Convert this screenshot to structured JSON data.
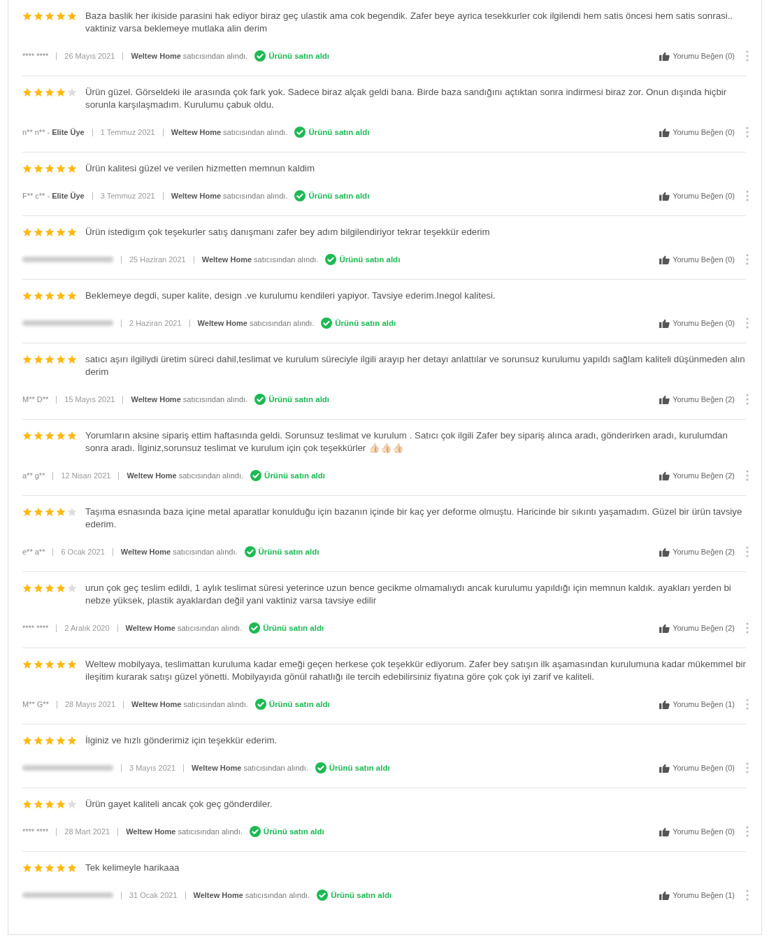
{
  "reviews": [
    {
      "stars": 5,
      "text": "Baza baslik her ikiside parasini hak ediyor biraz geç ulastik ama cok begendik. Zafer beye ayrica tesekkurler cok ilgilendi hem satis öncesi hem satis sonrasi.. vaktiniz varsa beklemeye mutlaka alin derim",
      "author": {
        "kind": "text",
        "name": "**** ****"
      },
      "date": "26 Mayıs 2021",
      "seller": "Weltew Home",
      "seller_note": "satıcısından alındı.",
      "verified": "Ürünü satın aldı",
      "like": "Yorumu Beğen (0)"
    },
    {
      "stars": 4,
      "text": "Ürün güzel. Görseldeki ile arasında çok fark yok. Sadece biraz alçak geldi bana. Birde baza sandığını açtıktan sonra indirmesi biraz zor. Onun dışında hiçbir sorunla karşılaşmadım. Kurulumu çabuk oldu.",
      "author": {
        "kind": "text",
        "name": "n** n** -",
        "badge": "Elite Üye"
      },
      "date": "1 Temmuz 2021",
      "seller": "Weltew Home",
      "seller_note": "satıcısından alındı.",
      "verified": "Ürünü satın aldı",
      "like": "Yorumu Beğen (0)"
    },
    {
      "stars": 5,
      "text": "Ürün kalitesi güzel ve verilen hizmetten memnun kaldim",
      "author": {
        "kind": "text",
        "name": "F** c** -",
        "badge": "Elite Üye"
      },
      "date": "3 Temmuz 2021",
      "seller": "Weltew Home",
      "seller_note": "satıcısından alındı.",
      "verified": "Ürünü satın aldı",
      "like": "Yorumu Beğen (0)"
    },
    {
      "stars": 5,
      "text": "Ürün istedigım çok teşekurler satış danışmanı zafer bey adım bilgilendiriyor tekrar teşekkür ederim",
      "author": {
        "kind": "blurred"
      },
      "date": "25 Haziran 2021",
      "seller": "Weltew Home",
      "seller_note": "satıcısından alındı.",
      "verified": "Ürünü satın aldı",
      "like": "Yorumu Beğen (0)"
    },
    {
      "stars": 5,
      "text": "Beklemeye degdi, super kalite, design .ve kurulumu kendileri yapiyor. Tavsiye ederim.Inegol kalitesi.",
      "author": {
        "kind": "blurred"
      },
      "date": "2 Haziran 2021",
      "seller": "Weltew Home",
      "seller_note": "satıcısından alındı.",
      "verified": "Ürünü satın aldı",
      "like": "Yorumu Beğen (0)"
    },
    {
      "stars": 5,
      "text": "satıcı aşırı ilgiliydi üretim süreci dahil,teslimat ve kurulum süreciyle ilgili arayıp her detayı anlattılar ve sorunsuz kurulumu yapıldı sağlam kaliteli düşünmeden alın derim",
      "author": {
        "kind": "text",
        "name": "M** D**"
      },
      "date": "15 Mayıs 2021",
      "seller": "Weltew Home",
      "seller_note": "satıcısından alındı.",
      "verified": "Ürünü satın aldı",
      "like": "Yorumu Beğen (2)"
    },
    {
      "stars": 5,
      "text": "Yorumların aksine sipariş ettim haftasında geldi. Sorunsuz teslimat ve kurulum . Satıcı çok ilgili Zafer bey sipariş alınca aradı, gönderirken aradı, kurulumdan sonra aradı. İlginiz,sorunsuz teslimat ve kurulum için çok teşekkürler 👍🏻👍🏻👍🏻",
      "author": {
        "kind": "text",
        "name": "a** g**"
      },
      "date": "12 Nisan 2021",
      "seller": "Weltew Home",
      "seller_note": "satıcısından alındı.",
      "verified": "Ürünü satın aldı",
      "like": "Yorumu Beğen (2)"
    },
    {
      "stars": 4,
      "text": "Taşıma esnasında baza içine metal aparatlar konulduğu için bazanın içinde bir kaç yer deforme olmuştu. Haricinde bir sıkıntı yaşamadım. Güzel bir ürün tavsiye ederim.",
      "author": {
        "kind": "text",
        "name": "e** a**"
      },
      "date": "6 Ocak 2021",
      "seller": "Weltew Home",
      "seller_note": "satıcısından alındı.",
      "verified": "Ürünü satın aldı",
      "like": "Yorumu Beğen (2)"
    },
    {
      "stars": 4,
      "text": "urun çok geç teslim edildi, 1 aylık teslimat süresi yeterince uzun bence gecikme olmamalıydı ancak kurulumu yapıldığı için memnun kaldık. ayakları yerden bi nebze yüksek, plastik ayaklardan değil yani vaktiniz varsa tavsiye edilir",
      "author": {
        "kind": "text",
        "name": "**** ****"
      },
      "date": "2 Aralık 2020",
      "seller": "Weltew Home",
      "seller_note": "satıcısından alındı.",
      "verified": "Ürünü satın aldı",
      "like": "Yorumu Beğen (2)"
    },
    {
      "stars": 5,
      "text": "Weltew mobilyaya, teslimattan kuruluma kadar emeği geçen herkese çok teşekkür ediyorum. Zafer bey satışın ilk aşamasından kurulumuna kadar mükemmel bir ileşitim kurarak satışı güzel yönetti. Mobilyayıda gönül rahatlığı ile tercih edebilirsiniz fiyatına göre çok çok iyi zarif ve kaliteli.",
      "author": {
        "kind": "text",
        "name": "M** G**"
      },
      "date": "28 Mayıs 2021",
      "seller": "Weltew Home",
      "seller_note": "satıcısından alındı.",
      "verified": "Ürünü satın aldı",
      "like": "Yorumu Beğen (1)"
    },
    {
      "stars": 5,
      "text": "İlginiz ve hızlı gönderimiz için teşekkür ederim.",
      "author": {
        "kind": "blurred"
      },
      "date": "3 Mayıs 2021",
      "seller": "Weltew Home",
      "seller_note": "satıcısından alındı.",
      "verified": "Ürünü satın aldı",
      "like": "Yorumu Beğen (0)"
    },
    {
      "stars": 4,
      "text": "Ürün gayet kaliteli ancak çok geç gönderdiler.",
      "author": {
        "kind": "text",
        "name": "**** ****"
      },
      "date": "28 Mart 2021",
      "seller": "Weltew Home",
      "seller_note": "satıcısından alındı.",
      "verified": "Ürünü satın aldı",
      "like": "Yorumu Beğen (0)"
    },
    {
      "stars": 5,
      "text": "Tek kelimeyle harikaaa",
      "author": {
        "kind": "blurred"
      },
      "date": "31 Ocak 2021",
      "seller": "Weltew Home",
      "seller_note": "satıcısından alındı.",
      "verified": "Ürünü satın aldı",
      "like": "Yorumu Beğen (1)"
    }
  ]
}
